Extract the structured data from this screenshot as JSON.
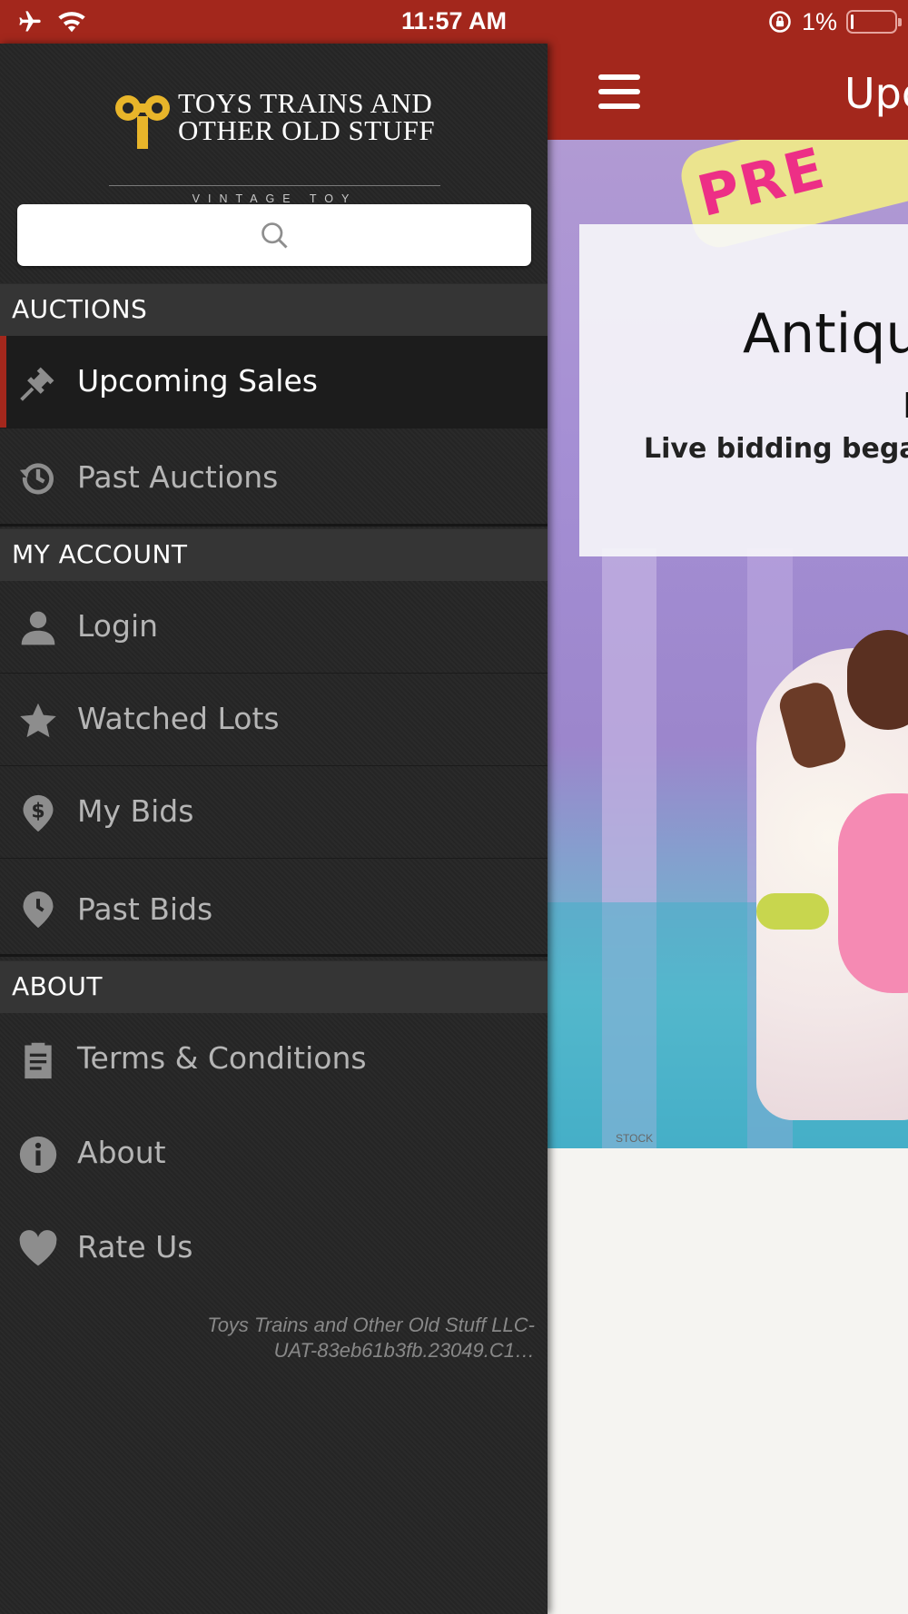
{
  "status_bar": {
    "time": "11:57 AM",
    "battery_text": "1%",
    "battery_level": 0.01,
    "icons": [
      "airplane-icon",
      "wifi-icon",
      "rotation-lock-icon",
      "battery-icon"
    ]
  },
  "app_header": {
    "title": "Upcoming Sales",
    "menu_icon": "hamburger-icon",
    "color": "#a3271c"
  },
  "featured_sale": {
    "title": "Antique",
    "subtitle": "L",
    "status_line": "Live bidding began",
    "image_sign_text": "PRE",
    "image_caption": "STOCK"
  },
  "drawer": {
    "logo": {
      "line1": "TOYS TRAINS AND",
      "line2": "OTHER OLD STUFF",
      "tagline": "VINTAGE TOY SPECIALISTS",
      "accent_color": "#e8b52a"
    },
    "search": {
      "placeholder": "",
      "icon": "search-icon"
    },
    "sections": [
      {
        "label": "AUCTIONS",
        "items": [
          {
            "label": "Upcoming Sales",
            "icon": "gavel-icon",
            "selected": true
          },
          {
            "label": "Past Auctions",
            "icon": "history-icon",
            "selected": false
          }
        ]
      },
      {
        "label": "MY ACCOUNT",
        "items": [
          {
            "label": "Login",
            "icon": "user-icon",
            "selected": false
          },
          {
            "label": "Watched Lots",
            "icon": "star-icon",
            "selected": false
          },
          {
            "label": "My Bids",
            "icon": "dollar-pin-icon",
            "selected": false
          },
          {
            "label": "Past Bids",
            "icon": "clock-pin-icon",
            "selected": false
          }
        ]
      },
      {
        "label": "ABOUT",
        "items": [
          {
            "label": "Terms & Conditions",
            "icon": "clipboard-icon",
            "selected": false
          },
          {
            "label": "About",
            "icon": "info-icon",
            "selected": false
          },
          {
            "label": "Rate Us",
            "icon": "heart-icon",
            "selected": false
          }
        ]
      }
    ],
    "version_line1": "Toys Trains and Other Old Stuff LLC-",
    "version_line2": "UAT-83eb61b3fb.23049.C1…",
    "selected_accent": "#a3271c"
  }
}
